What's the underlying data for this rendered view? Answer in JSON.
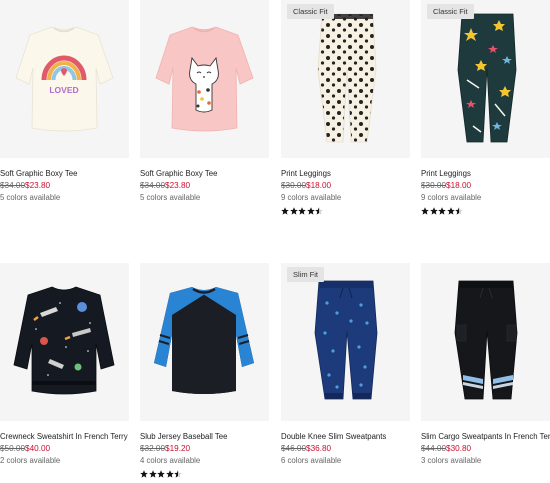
{
  "products": [
    {
      "name": "Soft Graphic Boxy Tee",
      "was": "$34.00",
      "now": "$23.80",
      "colors": "5 colors available",
      "badge": "",
      "rating": 0,
      "shirt_text": "LOVED"
    },
    {
      "name": "Soft Graphic Boxy Tee",
      "was": "$34.00",
      "now": "$23.80",
      "colors": "5 colors available",
      "badge": "",
      "rating": 0
    },
    {
      "name": "Print Leggings",
      "was": "$30.00",
      "now": "$18.00",
      "colors": "9 colors available",
      "badge": "Classic Fit",
      "rating": 4.5
    },
    {
      "name": "Print Leggings",
      "was": "$30.00",
      "now": "$18.00",
      "colors": "9 colors available",
      "badge": "Classic Fit",
      "rating": 4.5
    },
    {
      "name": "Crewneck Sweatshirt In French Terry",
      "was": "$50.00",
      "now": "$40.00",
      "colors": "2 colors available",
      "badge": "",
      "rating": 0
    },
    {
      "name": "Slub Jersey Baseball Tee",
      "was": "$32.00",
      "now": "$19.20",
      "colors": "4 colors available",
      "badge": "",
      "rating": 4.5
    },
    {
      "name": "Double Knee Slim Sweatpants",
      "was": "$46.00",
      "now": "$36.80",
      "colors": "6 colors available",
      "badge": "Slim Fit",
      "rating": 0
    },
    {
      "name": "Slim Cargo Sweatpants In French Terry",
      "was": "$44.00",
      "now": "$30.80",
      "colors": "3 colors available",
      "badge": "",
      "rating": 0
    }
  ],
  "colors": {
    "sale": "#c8102e",
    "muted": "#666666",
    "tile": "#f5f5f5",
    "badge": "#e4e4e4"
  }
}
